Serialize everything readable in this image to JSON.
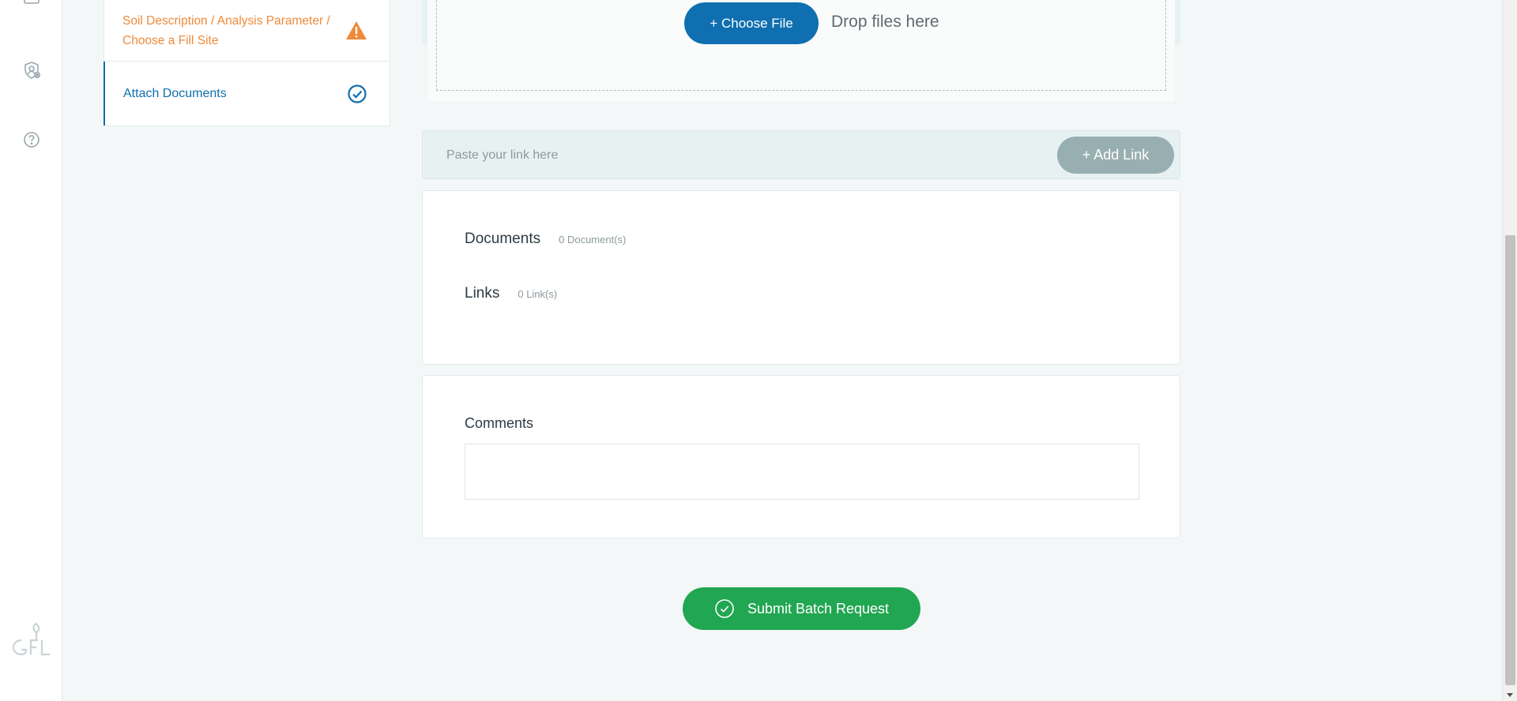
{
  "steps": [
    {
      "label": "Soil Description / Analysis Parameter / Choose a Fill Site",
      "status_icon": "warning-icon",
      "color": "#ef8a3a"
    },
    {
      "label": "Attach Documents",
      "status_icon": "check-circle-icon",
      "color": "#0f6fb0"
    }
  ],
  "upload": {
    "choose_label": "+ Choose File",
    "drop_text": "Drop files here"
  },
  "link": {
    "placeholder": "Paste your link here",
    "add_label": "+ Add Link"
  },
  "attachments": {
    "documents_title": "Documents",
    "documents_count": "0 Document(s)",
    "links_title": "Links",
    "links_count": "0 Link(s)"
  },
  "comments": {
    "title": "Comments",
    "value": ""
  },
  "submit": {
    "label": "Submit Batch Request"
  },
  "sidebar_icons": [
    "calendar-icon",
    "user-settings-icon",
    "help-icon"
  ],
  "colors": {
    "primary": "#0f6fb0",
    "warning": "#ef8a3a",
    "success": "#21a651",
    "disabled": "#98afb1"
  }
}
